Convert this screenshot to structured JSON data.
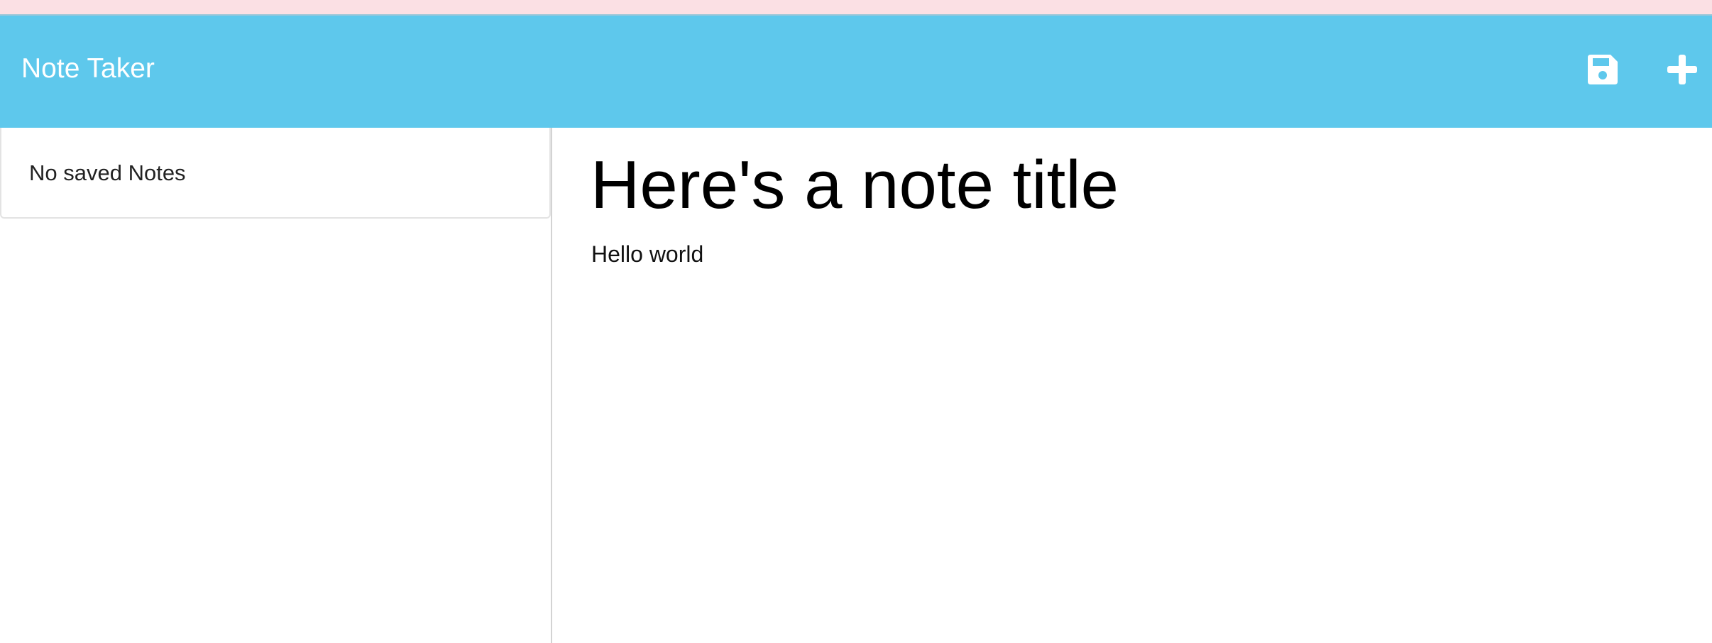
{
  "colors": {
    "navbar": "#5ec8ec",
    "top_strip": "#fbe0e4",
    "icon": "#ffffff"
  },
  "navbar": {
    "brand": "Note Taker",
    "save_icon": "floppy-disk-icon",
    "new_icon": "plus-icon"
  },
  "sidebar": {
    "empty_message": "No saved Notes"
  },
  "editor": {
    "title": "Here's a note title",
    "body": "Hello world"
  }
}
